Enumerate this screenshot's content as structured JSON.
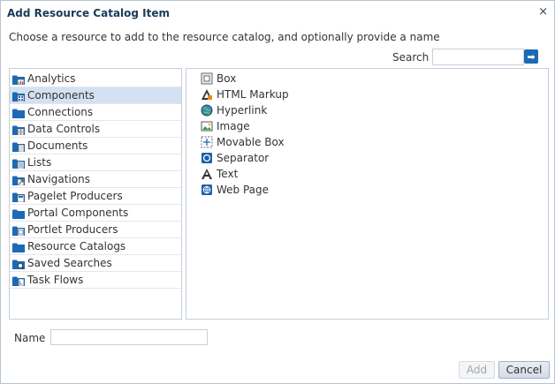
{
  "dialog": {
    "title": "Add Resource Catalog Item",
    "close_glyph": "×",
    "instructions": "Choose a resource to add to the resource catalog, and optionally provide a name"
  },
  "search": {
    "label": "Search",
    "value": "",
    "placeholder": "",
    "go_icon": "arrow-right-icon",
    "go_glyph": "➡"
  },
  "categories": {
    "selected_index": 1,
    "items": [
      {
        "label": "Analytics",
        "icon": "folder-chart-icon"
      },
      {
        "label": "Components",
        "icon": "folder-grid-icon"
      },
      {
        "label": "Connections",
        "icon": "folder-icon"
      },
      {
        "label": "Data Controls",
        "icon": "folder-table-icon"
      },
      {
        "label": "Documents",
        "icon": "folder-document-icon"
      },
      {
        "label": "Lists",
        "icon": "folder-list-icon"
      },
      {
        "label": "Navigations",
        "icon": "folder-nav-icon"
      },
      {
        "label": "Pagelet Producers",
        "icon": "folder-page-icon"
      },
      {
        "label": "Portal Components",
        "icon": "folder-icon"
      },
      {
        "label": "Portlet Producers",
        "icon": "folder-portlet-icon"
      },
      {
        "label": "Resource Catalogs",
        "icon": "folder-icon"
      },
      {
        "label": "Saved Searches",
        "icon": "folder-search-icon"
      },
      {
        "label": "Task Flows",
        "icon": "folder-flow-icon"
      }
    ]
  },
  "resources": {
    "items": [
      {
        "label": "Box",
        "icon": "box-icon"
      },
      {
        "label": "HTML Markup",
        "icon": "html-markup-icon"
      },
      {
        "label": "Hyperlink",
        "icon": "hyperlink-globe-icon"
      },
      {
        "label": "Image",
        "icon": "image-icon"
      },
      {
        "label": "Movable Box",
        "icon": "movable-box-icon"
      },
      {
        "label": "Separator",
        "icon": "separator-icon"
      },
      {
        "label": "Text",
        "icon": "text-icon"
      },
      {
        "label": "Web Page",
        "icon": "web-page-icon"
      }
    ]
  },
  "name_field": {
    "label": "Name",
    "value": "",
    "placeholder": ""
  },
  "buttons": {
    "add_label": "Add",
    "cancel_label": "Cancel"
  },
  "colors": {
    "title_text": "#1b3a5c",
    "selected_row": "#d3e1f1",
    "folder_blue": "#1b6ab3",
    "pane_border": "#c5ced9"
  }
}
